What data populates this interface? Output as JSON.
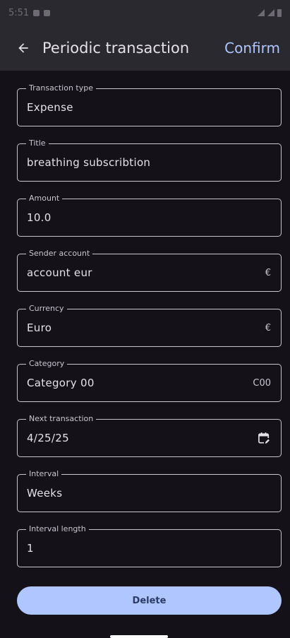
{
  "status_bar": {
    "time": "5:51"
  },
  "app_bar": {
    "title": "Periodic transaction",
    "confirm_label": "Confirm"
  },
  "fields": [
    {
      "label": "Transaction type",
      "value": "Expense",
      "suffix": ""
    },
    {
      "label": "Title",
      "value": "breathing subscribtion",
      "suffix": ""
    },
    {
      "label": "Amount",
      "value": "10.0",
      "suffix": ""
    },
    {
      "label": "Sender account",
      "value": "account eur",
      "suffix": "€"
    },
    {
      "label": "Currency",
      "value": "Euro",
      "suffix": "€"
    },
    {
      "label": "Category",
      "value": "Category 00",
      "suffix": "C00"
    },
    {
      "label": "Next transaction",
      "value": "4/25/25",
      "suffix": ""
    },
    {
      "label": "Interval",
      "value": "Weeks",
      "suffix": ""
    },
    {
      "label": "Interval length",
      "value": "1",
      "suffix": ""
    }
  ],
  "delete_label": "Delete",
  "icons": {
    "back": "arrow-back-icon",
    "calendar": "calendar-edit-icon"
  },
  "colors": {
    "accent": "#AFC6FF",
    "background": "#141218",
    "app_bar": "#2B2930",
    "outline": "#CAC4D0"
  }
}
